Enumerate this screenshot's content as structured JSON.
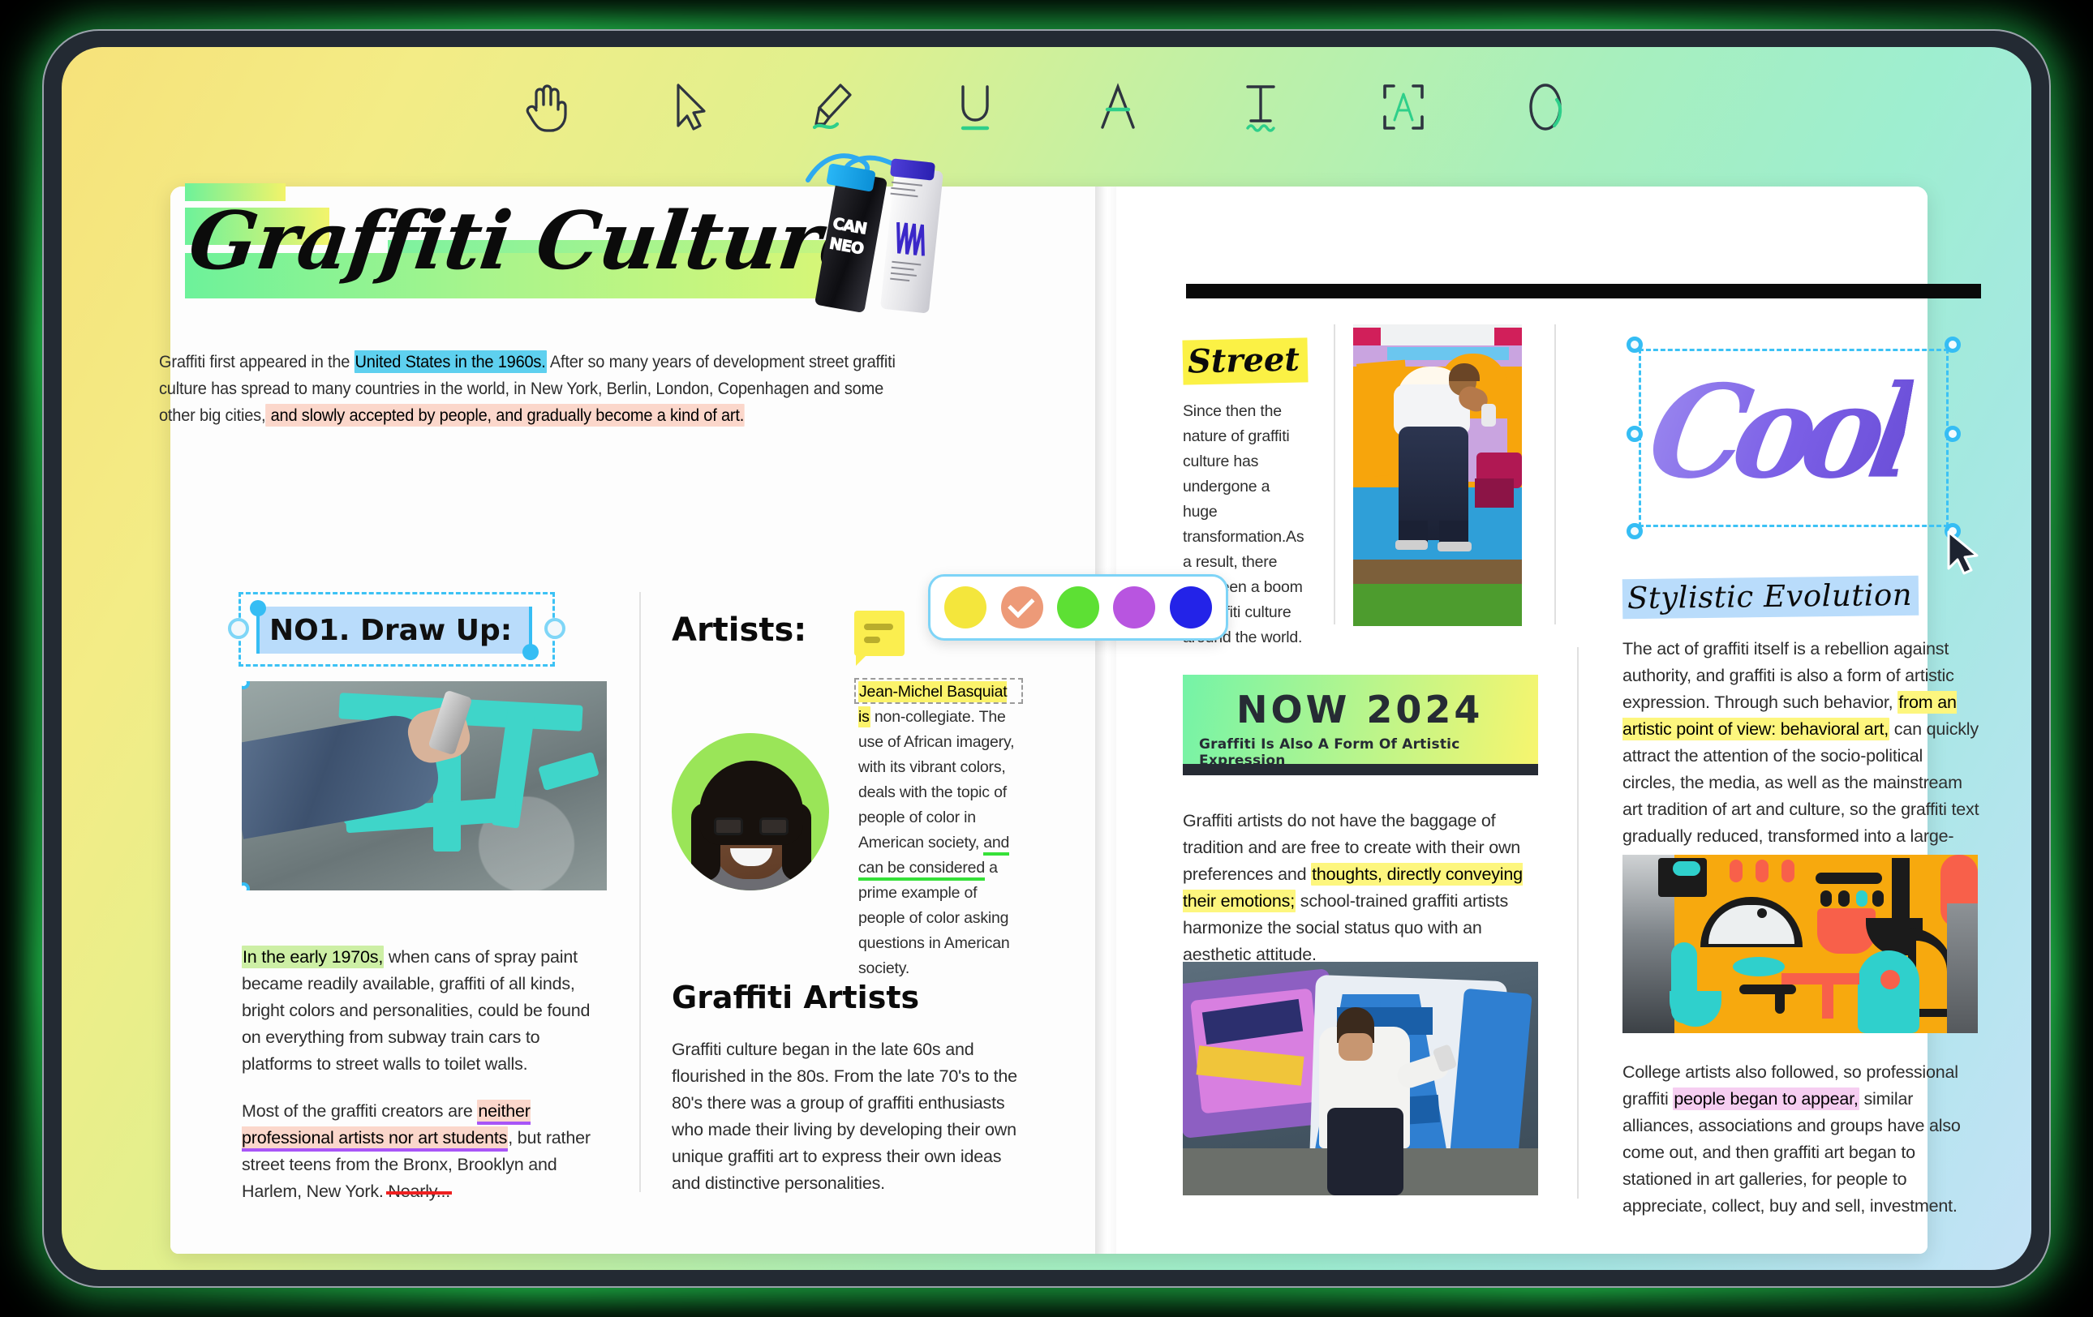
{
  "toolbar": {
    "tools": [
      {
        "name": "hand-tool",
        "label": "Hand"
      },
      {
        "name": "select-tool",
        "label": "Select"
      },
      {
        "name": "highlighter-tool",
        "label": "Highlight"
      },
      {
        "name": "underline-tool",
        "label": "Underline"
      },
      {
        "name": "strikethrough-tool",
        "label": "Strikethrough"
      },
      {
        "name": "text-tool",
        "label": "Text"
      },
      {
        "name": "area-select-tool",
        "label": "Area Select"
      },
      {
        "name": "eraser-tool",
        "label": "Eraser"
      }
    ]
  },
  "color_picker": {
    "selected_index": 1,
    "swatches": [
      {
        "name": "yellow",
        "hex": "#f4e63c"
      },
      {
        "name": "salmon",
        "hex": "#ed9a78"
      },
      {
        "name": "green",
        "hex": "#5de034"
      },
      {
        "name": "purple",
        "hex": "#b855e0"
      },
      {
        "name": "blue",
        "hex": "#2323e8"
      }
    ]
  },
  "left_page": {
    "title": "Graffiti Culture",
    "spray_can_label": "CAN NEO",
    "intro": {
      "p1": "Graffiti first appeared in the ",
      "hl_cyan": "United States in the 1960s.",
      "p2": " After so many years of development street graffiti culture has spread to many countries in the world, in New York, Berlin, London, Copenhagen and some other big cities,",
      "hl_pink": " and slowly accepted by people, and gradually become a kind of art."
    },
    "section_heading": "NO1. Draw Up:",
    "body_1": {
      "hl_green": "In the early 1970s,",
      "rest": " when cans of spray paint became readily available, graffiti of all kinds, bright colors and personalities, could be found on everything from subway train cars to platforms to street walls to toilet walls."
    },
    "body_2": {
      "lead": "Most of the graffiti creators are ",
      "hl_pink_ul": "neither professional artists nor art students",
      "mid": ", but rather street teens from the Bronx, Brooklyn and Harlem, New York. ",
      "struck": "Nearly..."
    },
    "artists_heading": "Artists:",
    "artist_para": {
      "hl_yellow": "Jean-Michel Basquiat is",
      "p1": " non-collegiate. The use of African imagery, with its vibrant colors, deals with the topic of people of color in American society, ",
      "ul_green": "and can be considered",
      "p2": " a prime example of people of color asking questions in American society."
    },
    "graffiti_artists_heading": "Graffiti Artists",
    "graffiti_artists_para": "Graffiti culture began in the late 60s and flourished in the 80s. From the late 70's to the 80's there was a group of graffiti enthusiasts who made their living by developing their own unique graffiti art to express their own ideas and distinctive personalities."
  },
  "right_page": {
    "street_heading": "Street",
    "street_para": "Since then the nature of graffiti culture has undergone a huge transformation.As a result, there has been a boom in graffiti culture around the world.",
    "now_banner": {
      "title": "NOW 2024",
      "subtitle": "Graffiti Is Also A Form Of Artistic Expression"
    },
    "now_para": {
      "p1": "Graffiti artists do not have the baggage of tradition and are free to create with their own preferences and ",
      "hl_yellow": "thoughts, directly conveying their emotions;",
      "p2": " school-trained graffiti artists harmonize the social status quo with an aesthetic attitude."
    },
    "cool_tag": "Cool",
    "stylistic_heading": "Stylistic Evolution",
    "stylistic_para": {
      "p1": "The act of graffiti itself is a rebellion against authority, and graffiti is also a form of artistic expression. Through such behavior, ",
      "hl_yellow": "from an artistic point of view: behavioral art,",
      "p2": " can quickly attract the attention of the socio-political circles, the media, as well as the mainstream art tradition of art and culture, so the graffiti text gradually reduced, transformed into a large-scale exquisite cartoon painting images."
    },
    "college_para": {
      "p1": "College artists also followed, so professional graffiti ",
      "hl_violet": "people began to appear,",
      "p2": " similar alliances, associations and groups have also come out, and then graffiti art began to stationed in art galleries, for people to appreciate, collect, buy and sell, investment."
    }
  }
}
